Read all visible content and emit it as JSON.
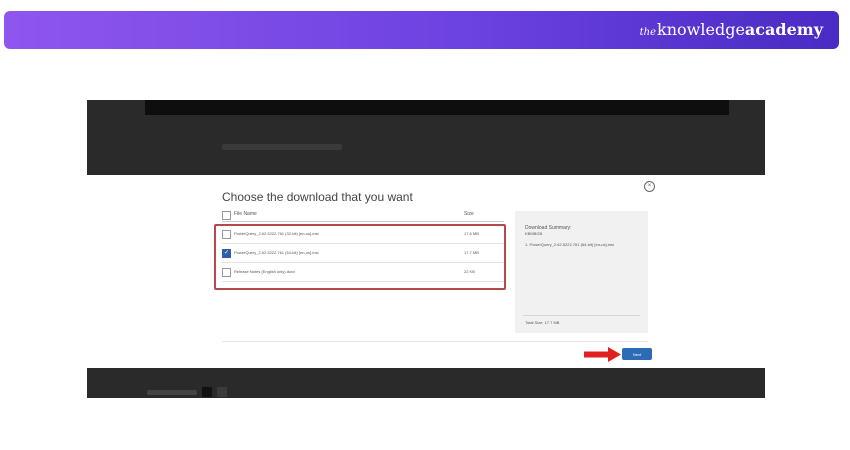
{
  "brand": {
    "prefix": "the",
    "word1": "knowledge",
    "word2": "academy"
  },
  "dialog": {
    "title": "Choose the download that you want",
    "close_glyph": "×",
    "columns": {
      "name": "File Name",
      "size": "Size"
    },
    "files": [
      {
        "name": "PowerQuery_2.62.5222.761 (32-bit) [en-us].msi",
        "size": "17.6 MB",
        "checked": false
      },
      {
        "name": "PowerQuery_2.62.5222.761 (64-bit) [en-us].msi",
        "size": "17.7 MB",
        "checked": true
      },
      {
        "name": "Release Notes (English only).docx",
        "size": "22 KB",
        "checked": false
      }
    ],
    "summary": {
      "title": "Download Summary:",
      "subtitle": "KBMBGB",
      "item": "1. PowerQuery_2.62.5222.761 (64-bit) [en-us].msi",
      "total": "Total Size: 17.7 MB"
    },
    "next_label": "Next"
  },
  "colors": {
    "accent": "#2e6bb5",
    "highlight": "#b5484b",
    "arrow": "#e02020",
    "banner_start": "#8f56ee",
    "banner_end": "#4a2bc4"
  }
}
